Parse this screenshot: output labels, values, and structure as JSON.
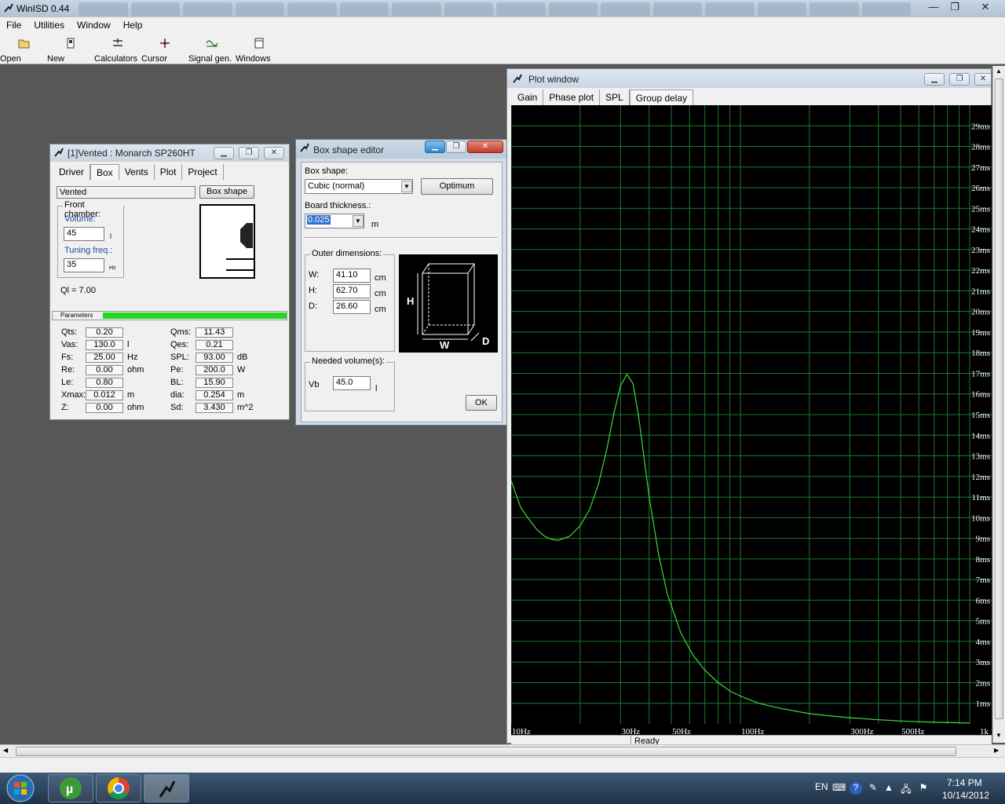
{
  "app": {
    "title": "WinISD 0.44",
    "window_controls": [
      "—",
      "❐",
      "✕"
    ]
  },
  "menu": [
    "File",
    "Utilities",
    "Window",
    "Help"
  ],
  "toolbar": [
    {
      "label": "Open",
      "icon": "folder-open-icon"
    },
    {
      "label": "New",
      "icon": "new-project-icon"
    },
    {
      "label": "Calculators",
      "icon": "calculator-icon"
    },
    {
      "label": "Cursor",
      "icon": "cursor-crosshair-icon"
    },
    {
      "label": "Signal gen.",
      "icon": "signal-generator-icon"
    },
    {
      "label": "Windows",
      "icon": "windows-icon"
    }
  ],
  "project_window": {
    "title": "[1]Vented : Monarch SP260HT",
    "tabs": [
      "Driver",
      "Box",
      "Vents",
      "Plot",
      "Project"
    ],
    "active_tab": "Box",
    "box_type": "Vented",
    "box_shape_button": "Box shape",
    "front_chamber_label": "Front chamber:",
    "volume_label": "Volume:",
    "volume_value": "45",
    "volume_unit": "l",
    "tuning_label": "Tuning freq.:",
    "tuning_value": "35",
    "tuning_unit": "Hz",
    "ql": "Ql = 7.00",
    "params_label": "Parameters",
    "params_left": [
      {
        "name": "Qts:",
        "value": "0.20",
        "unit": ""
      },
      {
        "name": "Vas:",
        "value": "130.0",
        "unit": "l"
      },
      {
        "name": "Fs:",
        "value": "25.00",
        "unit": "Hz"
      },
      {
        "name": "Re:",
        "value": "0.00",
        "unit": "ohm"
      },
      {
        "name": "Le:",
        "value": "0.80",
        "unit": ""
      },
      {
        "name": "Xmax:",
        "value": "0.012",
        "unit": "m"
      },
      {
        "name": "Z:",
        "value": "0.00",
        "unit": "ohm"
      }
    ],
    "params_right": [
      {
        "name": "Qms:",
        "value": "11.43",
        "unit": ""
      },
      {
        "name": "Qes:",
        "value": "0.21",
        "unit": ""
      },
      {
        "name": "SPL:",
        "value": "93.00",
        "unit": "dB"
      },
      {
        "name": "Pe:",
        "value": "200.0",
        "unit": "W"
      },
      {
        "name": "BL:",
        "value": "15.90",
        "unit": ""
      },
      {
        "name": "dia:",
        "value": "0.254",
        "unit": "m"
      },
      {
        "name": "Sd:",
        "value": "3.430",
        "unit": "m^2"
      }
    ]
  },
  "box_shape_editor": {
    "title": "Box shape editor",
    "box_shape_label": "Box shape:",
    "box_shape_value": "Cubic (normal)",
    "optimum_button": "Optimum",
    "board_thickness_label": "Board thickness.:",
    "board_thickness_value": "0.025",
    "board_thickness_unit": "m",
    "outer_dimensions_label": "Outer dimensions:",
    "dimensions": [
      {
        "name": "W:",
        "value": "41.10",
        "unit": "cm"
      },
      {
        "name": "H:",
        "value": "62.70",
        "unit": "cm"
      },
      {
        "name": "D:",
        "value": "26.60",
        "unit": "cm"
      }
    ],
    "diagram_labels": {
      "h": "H",
      "w": "W",
      "d": "D"
    },
    "needed_volume_label": "Needed volume(s):",
    "vb_label": "Vb",
    "vb_value": "45.0",
    "vb_unit": "l",
    "ok_button": "OK"
  },
  "plot_window": {
    "title": "Plot window",
    "tabs": [
      "Gain",
      "Phase plot",
      "SPL",
      "Group delay"
    ],
    "active_tab": "Group delay",
    "status": "Ready"
  },
  "chart_data": {
    "type": "line",
    "title": "",
    "xlabel": "",
    "ylabel": "",
    "x_scale": "log",
    "xlim": [
      10,
      1000
    ],
    "ylim": [
      0,
      30
    ],
    "x_ticks": [
      10,
      30,
      50,
      100,
      300,
      500,
      1000
    ],
    "x_tick_labels": [
      "10Hz",
      "30Hz",
      "50Hz",
      "100Hz",
      "300Hz",
      "500Hz",
      "1k"
    ],
    "y_ticks": [
      1,
      2,
      3,
      4,
      5,
      6,
      7,
      8,
      9,
      10,
      11,
      12,
      13,
      14,
      15,
      16,
      17,
      18,
      19,
      20,
      21,
      22,
      23,
      24,
      25,
      26,
      27,
      28,
      29
    ],
    "y_tick_labels": [
      "1ms",
      "2ms",
      "3ms",
      "4ms",
      "5ms",
      "6ms",
      "7ms",
      "8ms",
      "9ms",
      "10ms",
      "11ms",
      "12ms",
      "13ms",
      "14ms",
      "15ms",
      "16ms",
      "17ms",
      "18ms",
      "19ms",
      "20ms",
      "21ms",
      "22ms",
      "23ms",
      "24ms",
      "25ms",
      "26ms",
      "27ms",
      "28ms",
      "29ms"
    ],
    "grid": true,
    "background": "#000000",
    "grid_color": "#1f7a2e",
    "line_color": "#3ddc3d",
    "series": [
      {
        "x": [
          10,
          11,
          12,
          13,
          14,
          15,
          16,
          18,
          20,
          22,
          24,
          26,
          28,
          30,
          32,
          34,
          36,
          38,
          40,
          44,
          48,
          55,
          62,
          70,
          80,
          90,
          100,
          120,
          150,
          200,
          250,
          300,
          400,
          500,
          700,
          1000
        ],
        "y": [
          11.8,
          10.5,
          9.9,
          9.4,
          9.1,
          8.95,
          8.9,
          9.1,
          9.6,
          10.4,
          11.6,
          13.2,
          15.0,
          16.4,
          16.95,
          16.5,
          14.9,
          12.9,
          11.0,
          8.2,
          6.3,
          4.4,
          3.35,
          2.6,
          2.0,
          1.6,
          1.35,
          1.0,
          0.75,
          0.5,
          0.38,
          0.3,
          0.2,
          0.14,
          0.08,
          0.04
        ]
      }
    ]
  },
  "taskbar": {
    "lang": "EN",
    "time": "7:14 PM",
    "date": "10/14/2012",
    "apps": [
      "start-orb-icon",
      "utorrent-icon",
      "chrome-icon",
      "winisd-icon"
    ]
  }
}
